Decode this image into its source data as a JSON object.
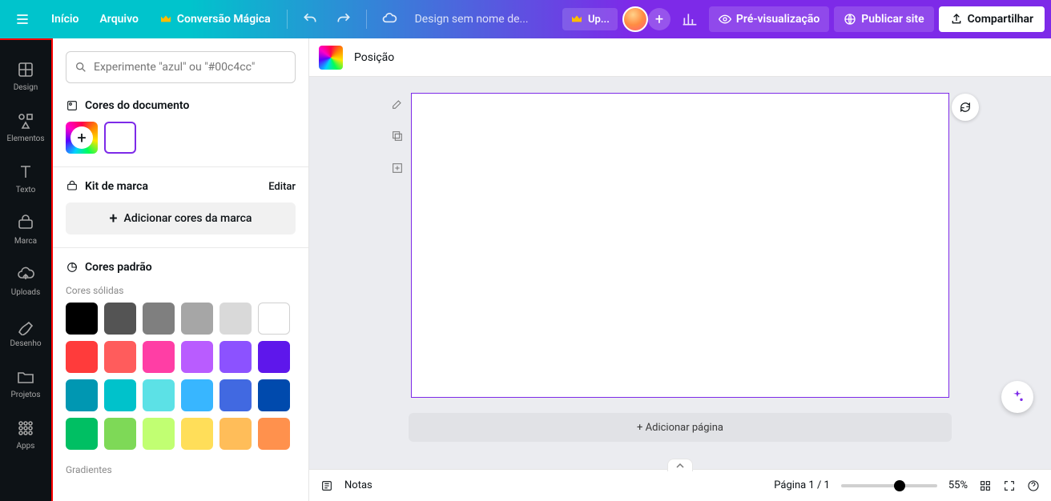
{
  "topbar": {
    "home": "Início",
    "file": "Arquivo",
    "magic": "Conversão Mágica",
    "doc_title": "Design sem nome de...",
    "upgrade": "Up...",
    "preview": "Pré-visualização",
    "publish": "Publicar site",
    "share": "Compartilhar",
    "plus": "+"
  },
  "rail": {
    "items": [
      {
        "label": "Design"
      },
      {
        "label": "Elementos"
      },
      {
        "label": "Texto"
      },
      {
        "label": "Marca"
      },
      {
        "label": "Uploads"
      },
      {
        "label": "Desenho"
      },
      {
        "label": "Projetos"
      },
      {
        "label": "Apps"
      }
    ]
  },
  "panel": {
    "search_placeholder": "Experimente \"azul\" ou \"#00c4cc\"",
    "doc_colors_hdr": "Cores do documento",
    "brand_kit_hdr": "Kit de marca",
    "edit": "Editar",
    "add_brand_colors": "Adicionar cores da marca",
    "default_colors_hdr": "Cores padrão",
    "solid_label": "Cores sólidas",
    "gradients_label": "Gradientes",
    "colors": [
      "#000000",
      "#545454",
      "#7f7f7f",
      "#a6a6a6",
      "#d9d9d9",
      "#ffffff",
      "#ff3b3b",
      "#ff5c5c",
      "#ff3ea5",
      "#b95cff",
      "#8c52ff",
      "#5e17eb",
      "#0097b2",
      "#00c2cb",
      "#5ce1e6",
      "#38b6ff",
      "#4169e1",
      "#004aad",
      "#00bf63",
      "#7ed957",
      "#c1ff72",
      "#ffde59",
      "#ffbd59",
      "#ff914d"
    ]
  },
  "secondbar": {
    "position": "Posição"
  },
  "canvas": {
    "add_page": "+ Adicionar página"
  },
  "footer": {
    "notes": "Notas",
    "page_counter": "Página 1 / 1",
    "zoom": "55%"
  }
}
